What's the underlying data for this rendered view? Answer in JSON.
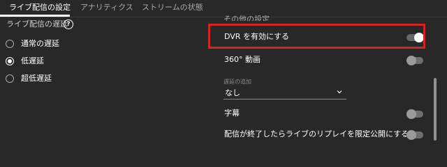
{
  "tabs": [
    {
      "label": "ライブ配信の設定",
      "active": true
    },
    {
      "label": "アナリティクス",
      "active": false
    },
    {
      "label": "ストリームの状態",
      "active": false
    }
  ],
  "latency": {
    "title": "ライブ配信の遅延",
    "help_icon": "help-circle-icon",
    "options": [
      {
        "label": "通常の遅延",
        "checked": false
      },
      {
        "label": "低遅延",
        "checked": true
      },
      {
        "label": "超低遅延",
        "checked": false
      }
    ]
  },
  "other_settings": {
    "section_title": "その他の設定",
    "dvr": {
      "label": "DVR を有効にする",
      "enabled": true
    },
    "video_360": {
      "label": "360° 動画",
      "enabled": false
    },
    "delay": {
      "label": "遅延の追加",
      "value": "なし"
    },
    "captions": {
      "label": "字幕",
      "enabled": false
    },
    "unlisted_replay": {
      "label": "配信が終了したらライブのリプレイを限定公開にする",
      "enabled": false
    }
  },
  "colors": {
    "background": "#282828",
    "highlight": "#d32424",
    "toggle_on_knob": "#ffffff"
  }
}
